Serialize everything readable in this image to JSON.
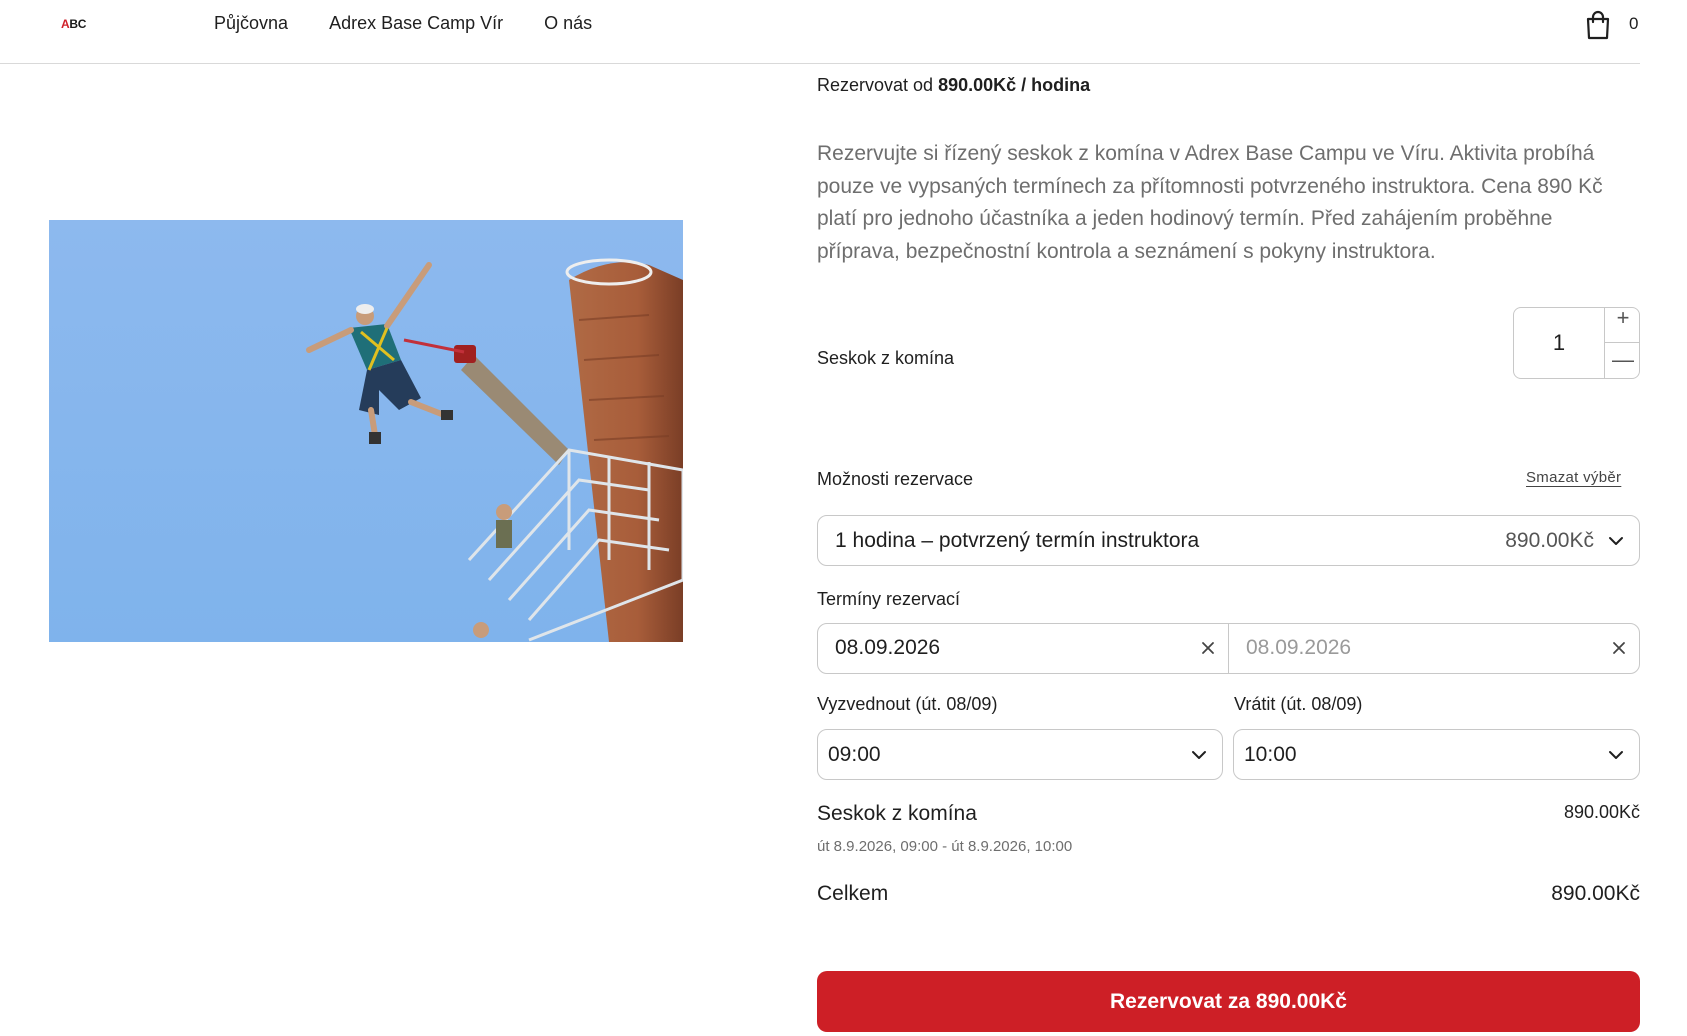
{
  "header": {
    "logo_a": "A",
    "logo_rest": "BC",
    "nav": [
      "Půjčovna",
      "Adrex Base Camp Vír",
      "O nás"
    ],
    "cart_count": "0"
  },
  "product": {
    "price_prefix": "Rezervovat od ",
    "price_value": "890.00Kč / hodina",
    "description": "Rezervujte si řízený seskok z komína v Adrex Base Campu ve Víru. Aktivita probíhá pouze ve vypsaných termínech za přítomnosti potvrzeného instruktora. Cena 890 Kč platí pro jednoho účastníka a jeden hodinový termín. Před zahájením proběhne příprava, bezpečnostní kontrola a seznámení s pokyny instruktora.",
    "qty_label": "Seskok z komína",
    "qty_value": "1",
    "qty_plus": "+",
    "qty_minus": "—"
  },
  "booking": {
    "options_label": "Možnosti rezervace",
    "clear_label": "Smazat výběr",
    "option_selected": "1 hodina – potvrzený termín instruktora",
    "option_price": "890.00Kč",
    "dates_label": "Termíny rezervací",
    "date_from": "08.09.2026",
    "date_to": "08.09.2026",
    "pickup_label": "Vyzvednout (út. 08/09)",
    "pickup_time": "09:00",
    "return_label": "Vrátit (út. 08/09)",
    "return_time": "10:00"
  },
  "summary": {
    "item_title": "Seskok z komína",
    "item_price": "890.00Kč",
    "item_range": "út 8.9.2026, 09:00 - út 8.9.2026, 10:00",
    "total_label": "Celkem",
    "total_value": "890.00Kč",
    "cta_label": "Rezervovat za 890.00Kč"
  },
  "colors": {
    "accent": "#cd1f26",
    "border": "#c8c8c8",
    "muted_text": "#6e6e6e"
  },
  "icons": [
    "shopping-bag-icon",
    "chevron-down-icon",
    "close-icon"
  ]
}
